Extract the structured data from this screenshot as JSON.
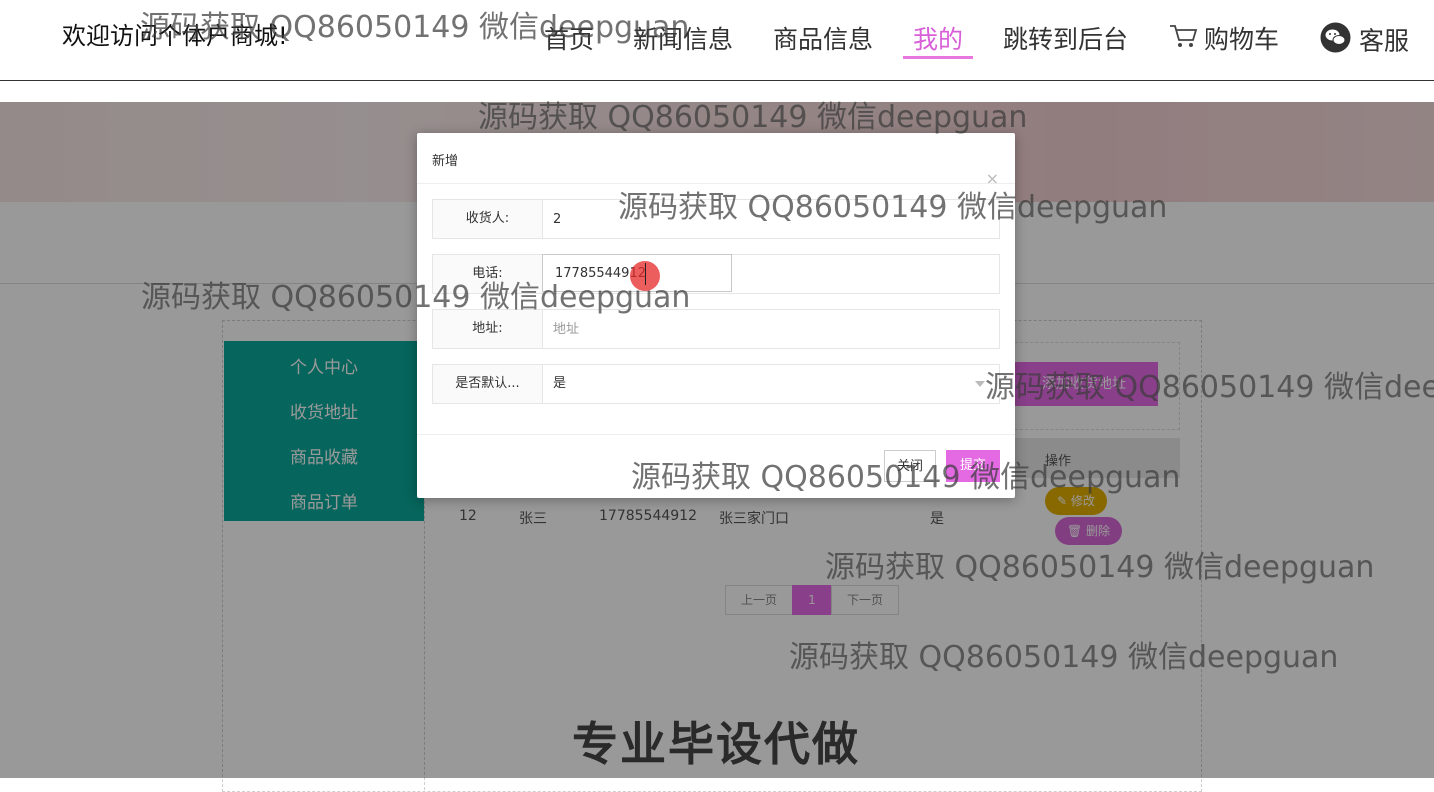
{
  "header": {
    "welcome": "欢迎访问个体户商城!",
    "nav": [
      "首页",
      "新闻信息",
      "商品信息",
      "我的",
      "跳转到后台",
      "购物车",
      "客服"
    ],
    "active": "我的"
  },
  "sidebar": {
    "items": [
      "个人中心",
      "收货地址",
      "商品收藏",
      "商品订单"
    ]
  },
  "address_page": {
    "add_button": "添加收货地址",
    "op_header": "操作",
    "row": {
      "id": "12",
      "name": "张三",
      "phone": "17785544912",
      "address": "张三家门口",
      "is_default": "是"
    },
    "edit_label": "✎ 修改",
    "delete_label": "🗑 删除"
  },
  "pager": {
    "prev": "上一页",
    "current": "1",
    "next": "下一页"
  },
  "dialog": {
    "title": "新增",
    "close_icon": "×",
    "fields": {
      "receiver": {
        "label": "收货人:",
        "value": "2"
      },
      "phone": {
        "label": "电话:",
        "value": "17785544912"
      },
      "address": {
        "label": "地址:",
        "placeholder": "地址"
      },
      "is_default": {
        "label": "是否默认...",
        "value": "是"
      }
    },
    "close_button": "关闭",
    "submit_button": "提交"
  },
  "watermarks": [
    "源码获取 QQ86050149 微信deepguan",
    "源码获取 QQ86050149 微信deepguan",
    "源码获取 QQ86050149 微信deepguan",
    "源码获取 QQ86050149 微信deepguan",
    "源码获取 QQ86050149 微信deep",
    "源码获取 QQ86050149 微信deepguan",
    "源码获取 QQ86050149 微信deepguan",
    "源码获取 QQ86050149 微信deepguan"
  ],
  "promo": "专业毕设代做",
  "colors": {
    "accent": "#e46ae4",
    "sidebar": "#0aa99a",
    "edit": "#e3b000"
  }
}
